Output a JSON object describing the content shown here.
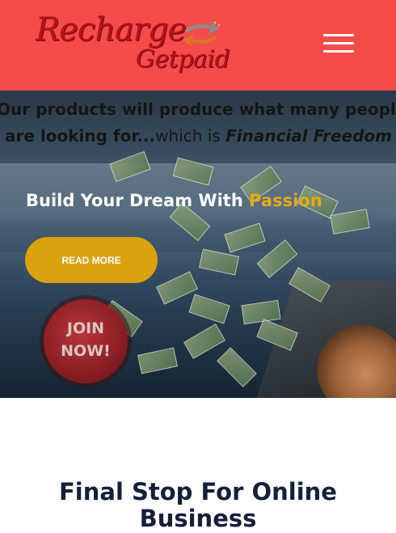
{
  "header": {
    "logo_word1": "Recharge",
    "logo_word2": "Getpaid",
    "menu_icon": "hamburger-menu-icon",
    "background_color": "#f44b4b"
  },
  "hero": {
    "marquee_line1": "Our products will produce what many people",
    "marquee_line2_bold": "are looking for...",
    "marquee_line2_regular": "which is ",
    "marquee_line2_italic": "Financial Freedom",
    "headline_prefix": "Build Your Dream With ",
    "headline_accent": "Passion",
    "accent_color": "#e6a91a",
    "cta_label": "READ MORE",
    "cta_color": "#dba10e",
    "join_line1": "JOIN",
    "join_line2": "NOW!"
  },
  "section": {
    "title_line1": "Final Stop For Online",
    "title_line2": "Business"
  }
}
